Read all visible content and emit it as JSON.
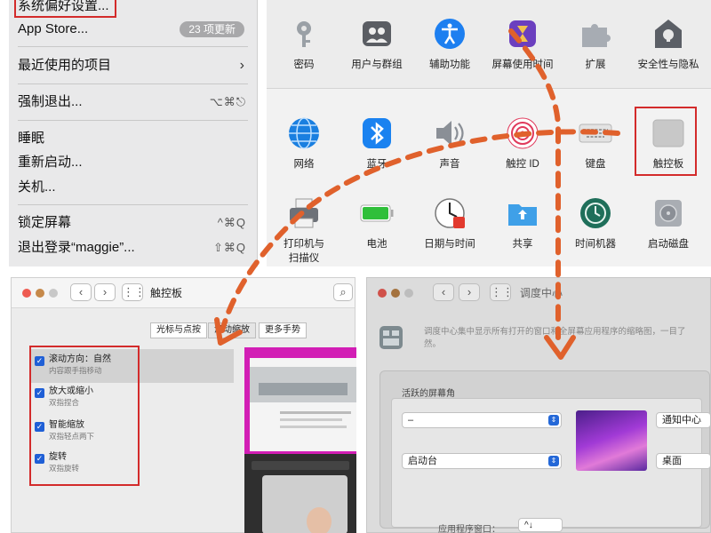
{
  "apple_menu": {
    "system_prefs": "系统偏好设置...",
    "app_store": "App Store...",
    "app_store_badge": "23 项更新",
    "recent_items": "最近使用的项目",
    "force_quit": "强制退出...",
    "force_quit_shortcut": "⌥⌘⎋",
    "sleep": "睡眠",
    "restart": "重新启动...",
    "shutdown": "关机...",
    "lock_screen": "锁定屏幕",
    "lock_screen_shortcut": "^⌘Q",
    "logout": "退出登录“maggie”...",
    "logout_shortcut": "⇧⌘Q"
  },
  "prefs": {
    "row1": [
      {
        "label": "密码",
        "icon": "key-icon"
      },
      {
        "label": "用户与群组",
        "icon": "users-groups-icon"
      },
      {
        "label": "辅助功能",
        "icon": "accessibility-icon"
      },
      {
        "label": "屏幕使用时间",
        "icon": "screen-time-icon"
      },
      {
        "label": "扩展",
        "icon": "extensions-icon"
      },
      {
        "label": "安全性与隐私",
        "icon": "security-privacy-icon"
      }
    ],
    "row2": [
      {
        "label": "网络",
        "icon": "network-icon"
      },
      {
        "label": "蓝牙",
        "icon": "bluetooth-icon"
      },
      {
        "label": "声音",
        "icon": "sound-icon"
      },
      {
        "label": "触控 ID",
        "icon": "touch-id-icon"
      },
      {
        "label": "键盘",
        "icon": "keyboard-icon"
      },
      {
        "label": "触控板",
        "icon": "trackpad-icon"
      }
    ],
    "row3": [
      {
        "label": "打印机与扫描仪",
        "icon": "printer-icon"
      },
      {
        "label": "电池",
        "icon": "battery-icon"
      },
      {
        "label": "日期与时间",
        "icon": "date-time-icon"
      },
      {
        "label": "共享",
        "icon": "sharing-icon"
      },
      {
        "label": "时间机器",
        "icon": "time-machine-icon"
      },
      {
        "label": "启动磁盘",
        "icon": "startup-disk-icon"
      }
    ],
    "row3_label_line1": "打印机与",
    "row3_label_line2": "扫描仪"
  },
  "trackpad_window": {
    "title": "触控板",
    "tabs": [
      "光标与点按",
      "滚动缩放",
      "更多手势"
    ],
    "items": [
      {
        "title": "滚动方向：自然",
        "sub": "内容跟手指移动"
      },
      {
        "title": "放大或缩小",
        "sub": "双指捏合"
      },
      {
        "title": "智能缩放",
        "sub": "双指轻点两下"
      },
      {
        "title": "旋转",
        "sub": "双指旋转"
      }
    ]
  },
  "mission_window": {
    "title": "调度中心",
    "desc": "调度中心集中显示所有打开的窗口和全屏幕应用程序的缩略图，一目了然。",
    "hot_corners": "活跃的屏幕角",
    "top_left": "–",
    "bottom_left": "启动台",
    "top_right": "通知中心",
    "bottom_right": "桌面",
    "app_windows_label": "应用程序窗口：",
    "app_windows_value": "^↓"
  },
  "colors": {
    "highlight_red": "#d32b2b",
    "arrow_orange": "#e0612c",
    "accent_blue": "#2468d8"
  }
}
